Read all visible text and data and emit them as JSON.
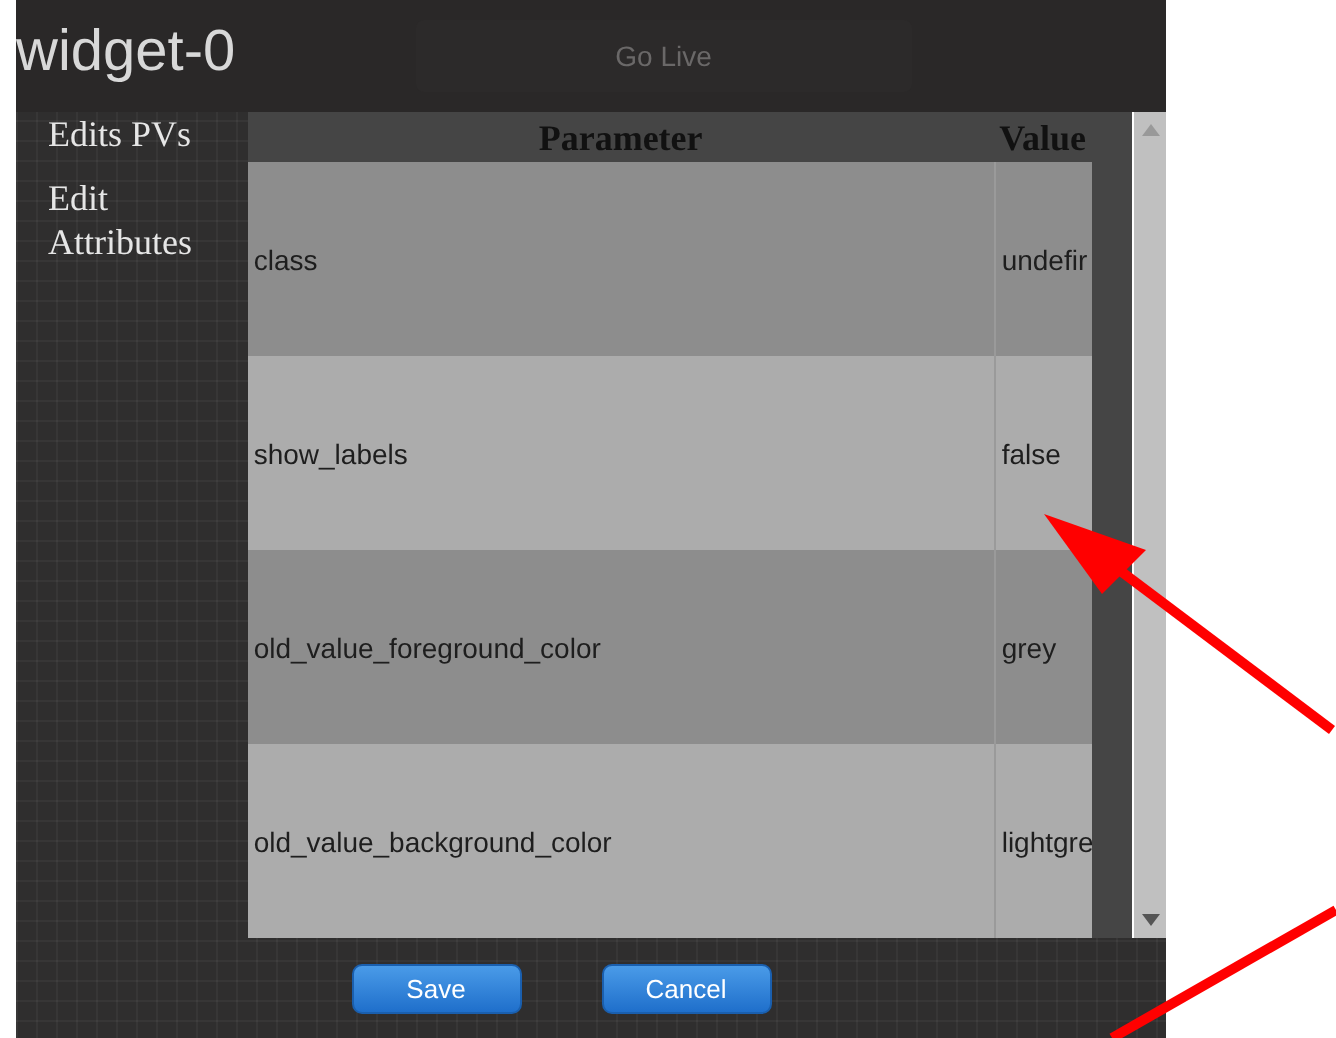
{
  "dialog": {
    "title": "widget-0",
    "background_button": "Go Live"
  },
  "sidebar": {
    "items": [
      {
        "label": "Edits PVs"
      },
      {
        "label": "Edit Attributes"
      }
    ]
  },
  "table": {
    "columns": [
      "Parameter",
      "Value"
    ],
    "rows": [
      {
        "parameter": "class",
        "value": "undefir"
      },
      {
        "parameter": "show_labels",
        "value": "false"
      },
      {
        "parameter": "old_value_foreground_color",
        "value": "grey"
      },
      {
        "parameter": "old_value_background_color",
        "value": "lightgre"
      }
    ]
  },
  "buttons": [
    "Save",
    "Cancel"
  ]
}
